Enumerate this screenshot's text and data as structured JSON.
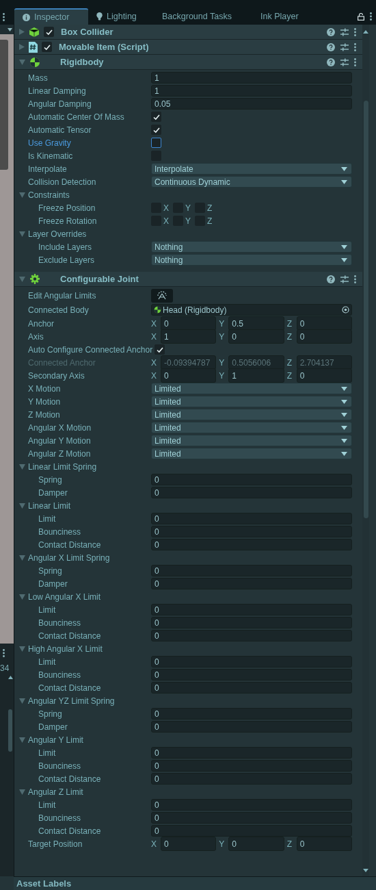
{
  "tabs": [
    {
      "label": "Inspector",
      "selected": true
    },
    {
      "label": "Lighting",
      "selected": false
    },
    {
      "label": "Background Tasks",
      "selected": false
    },
    {
      "label": "Ink Player",
      "selected": false
    }
  ],
  "side_panel": {
    "counter": "34"
  },
  "components": [
    {
      "name": "Box Collider",
      "expanded": false,
      "enabled": true
    },
    {
      "name": "Movable Item (Script)",
      "expanded": false,
      "enabled": true
    },
    {
      "name": "Rigidbody",
      "expanded": true,
      "properties": [
        {
          "kind": "float",
          "label": "Mass",
          "value": "1"
        },
        {
          "kind": "float",
          "label": "Linear Damping",
          "value": "1"
        },
        {
          "kind": "float",
          "label": "Angular Damping",
          "value": "0.05"
        },
        {
          "kind": "check",
          "label": "Automatic Center Of Mass",
          "checked": true,
          "focused": false
        },
        {
          "kind": "check",
          "label": "Automatic Tensor",
          "checked": true,
          "focused": false
        },
        {
          "kind": "check",
          "label": "Use Gravity",
          "checked": false,
          "focused": true
        },
        {
          "kind": "check",
          "label": "Is Kinematic",
          "checked": false,
          "focused": false
        },
        {
          "kind": "dropdown",
          "label": "Interpolate",
          "value": "Interpolate"
        },
        {
          "kind": "dropdown",
          "label": "Collision Detection",
          "value": "Continuous Dynamic"
        },
        {
          "kind": "foldout",
          "label": "Constraints",
          "expanded": true,
          "children": [
            {
              "kind": "toggles",
              "label": "Freeze Position",
              "axes": [
                {
                  "label": "X",
                  "checked": false
                },
                {
                  "label": "Y",
                  "checked": false
                },
                {
                  "label": "Z",
                  "checked": false
                }
              ]
            },
            {
              "kind": "toggles",
              "label": "Freeze Rotation",
              "axes": [
                {
                  "label": "X",
                  "checked": false
                },
                {
                  "label": "Y",
                  "checked": false
                },
                {
                  "label": "Z",
                  "checked": false
                }
              ]
            }
          ]
        },
        {
          "kind": "foldout",
          "label": "Layer Overrides",
          "expanded": true,
          "children": [
            {
              "kind": "dropdown",
              "label": "Include Layers",
              "value": "Nothing"
            },
            {
              "kind": "dropdown",
              "label": "Exclude Layers",
              "value": "Nothing"
            }
          ]
        }
      ]
    },
    {
      "name": "Configurable Joint",
      "expanded": true,
      "properties": [
        {
          "kind": "button",
          "label": "Edit Angular Limits"
        },
        {
          "kind": "object",
          "label": "Connected Body",
          "value": "Head (Rigidbody)"
        },
        {
          "kind": "vector",
          "label": "Anchor",
          "disabled": false,
          "axes": [
            {
              "label": "X",
              "value": "0"
            },
            {
              "label": "Y",
              "value": "0.5"
            },
            {
              "label": "Z",
              "value": "0"
            }
          ]
        },
        {
          "kind": "vector",
          "label": "Axis",
          "disabled": false,
          "axes": [
            {
              "label": "X",
              "value": "1"
            },
            {
              "label": "Y",
              "value": "0"
            },
            {
              "label": "Z",
              "value": "0"
            }
          ]
        },
        {
          "kind": "check",
          "label": "Auto Configure Connected Anchor",
          "checked": true,
          "focused": false
        },
        {
          "kind": "vector",
          "label": "Connected Anchor",
          "disabled": true,
          "axes": [
            {
              "label": "X",
              "value": "-0.09394787"
            },
            {
              "label": "Y",
              "value": "0.5056006"
            },
            {
              "label": "Z",
              "value": "2.704137"
            }
          ]
        },
        {
          "kind": "vector",
          "label": "Secondary Axis",
          "disabled": false,
          "axes": [
            {
              "label": "X",
              "value": "0"
            },
            {
              "label": "Y",
              "value": "1"
            },
            {
              "label": "Z",
              "value": "0"
            }
          ]
        },
        {
          "kind": "dropdown",
          "label": "X Motion",
          "value": "Limited"
        },
        {
          "kind": "dropdown",
          "label": "Y Motion",
          "value": "Limited"
        },
        {
          "kind": "dropdown",
          "label": "Z Motion",
          "value": "Limited"
        },
        {
          "kind": "dropdown",
          "label": "Angular X Motion",
          "value": "Limited"
        },
        {
          "kind": "dropdown",
          "label": "Angular Y Motion",
          "value": "Limited"
        },
        {
          "kind": "dropdown",
          "label": "Angular Z Motion",
          "value": "Limited"
        },
        {
          "kind": "foldout",
          "label": "Linear Limit Spring",
          "expanded": true,
          "children": [
            {
              "kind": "float",
              "label": "Spring",
              "value": "0"
            },
            {
              "kind": "float",
              "label": "Damper",
              "value": "0"
            }
          ]
        },
        {
          "kind": "foldout",
          "label": "Linear Limit",
          "expanded": true,
          "children": [
            {
              "kind": "float",
              "label": "Limit",
              "value": "0"
            },
            {
              "kind": "float",
              "label": "Bounciness",
              "value": "0"
            },
            {
              "kind": "float",
              "label": "Contact Distance",
              "value": "0"
            }
          ]
        },
        {
          "kind": "foldout",
          "label": "Angular X Limit Spring",
          "expanded": true,
          "children": [
            {
              "kind": "float",
              "label": "Spring",
              "value": "0"
            },
            {
              "kind": "float",
              "label": "Damper",
              "value": "0"
            }
          ]
        },
        {
          "kind": "foldout",
          "label": "Low Angular X Limit",
          "expanded": true,
          "children": [
            {
              "kind": "float",
              "label": "Limit",
              "value": "0"
            },
            {
              "kind": "float",
              "label": "Bounciness",
              "value": "0"
            },
            {
              "kind": "float",
              "label": "Contact Distance",
              "value": "0"
            }
          ]
        },
        {
          "kind": "foldout",
          "label": "High Angular X Limit",
          "expanded": true,
          "children": [
            {
              "kind": "float",
              "label": "Limit",
              "value": "0"
            },
            {
              "kind": "float",
              "label": "Bounciness",
              "value": "0"
            },
            {
              "kind": "float",
              "label": "Contact Distance",
              "value": "0"
            }
          ]
        },
        {
          "kind": "foldout",
          "label": "Angular YZ Limit Spring",
          "expanded": true,
          "children": [
            {
              "kind": "float",
              "label": "Spring",
              "value": "0"
            },
            {
              "kind": "float",
              "label": "Damper",
              "value": "0"
            }
          ]
        },
        {
          "kind": "foldout",
          "label": "Angular Y Limit",
          "expanded": true,
          "children": [
            {
              "kind": "float",
              "label": "Limit",
              "value": "0"
            },
            {
              "kind": "float",
              "label": "Bounciness",
              "value": "0"
            },
            {
              "kind": "float",
              "label": "Contact Distance",
              "value": "0"
            }
          ]
        },
        {
          "kind": "foldout",
          "label": "Angular Z Limit",
          "expanded": true,
          "children": [
            {
              "kind": "float",
              "label": "Limit",
              "value": "0"
            },
            {
              "kind": "float",
              "label": "Bounciness",
              "value": "0"
            },
            {
              "kind": "float",
              "label": "Contact Distance",
              "value": "0"
            }
          ]
        },
        {
          "kind": "vector",
          "label": "Target Position",
          "disabled": false,
          "axes": [
            {
              "label": "X",
              "value": "0"
            },
            {
              "label": "Y",
              "value": "0"
            },
            {
              "label": "Z",
              "value": "0"
            }
          ]
        }
      ]
    }
  ],
  "footer": {
    "title": "Asset Labels"
  }
}
